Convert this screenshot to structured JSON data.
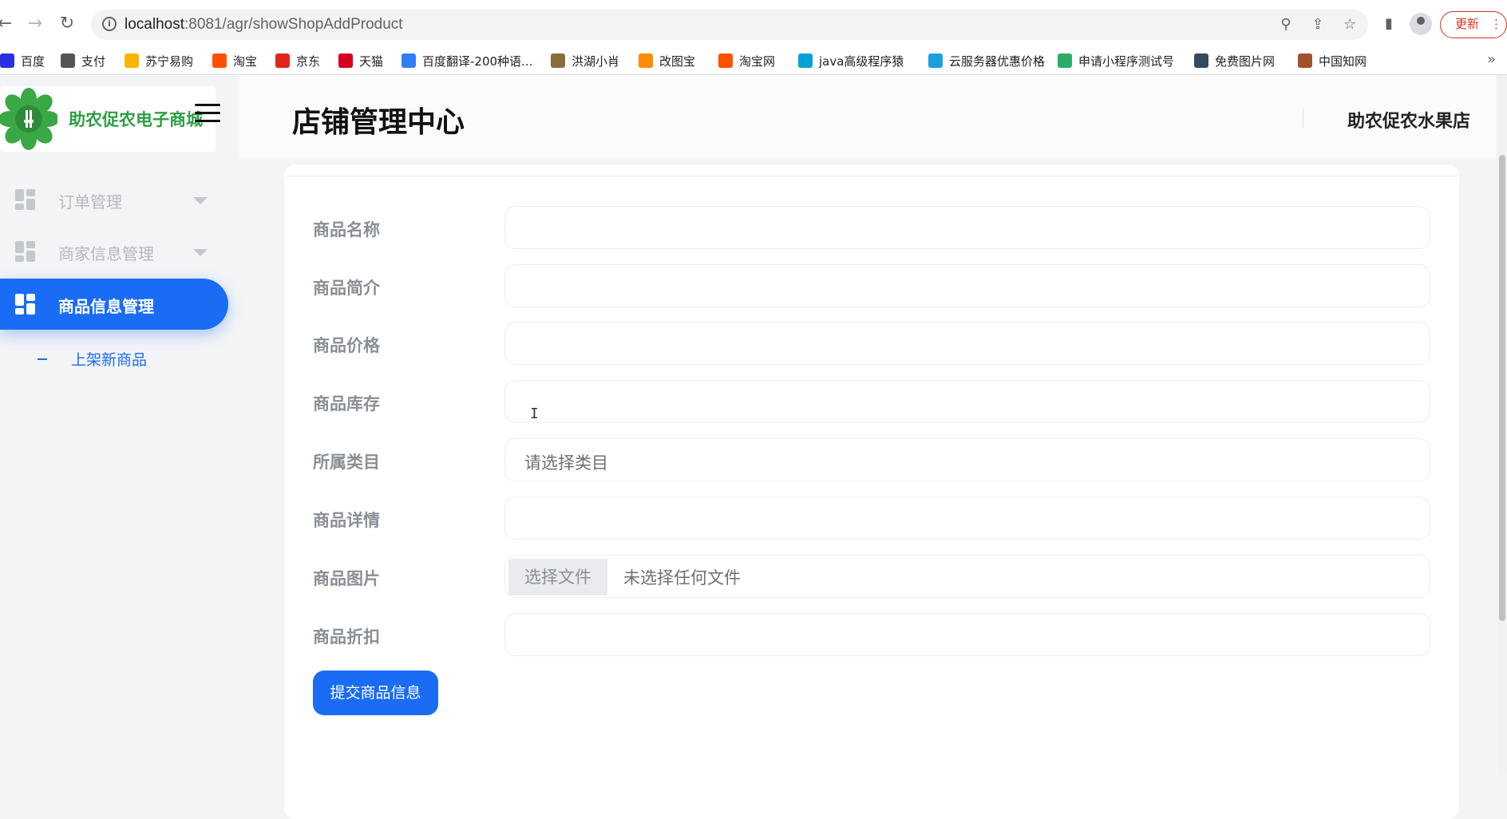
{
  "browser": {
    "url_host": "localhost",
    "url_rest": ":8081/agr/showShopAddProduct",
    "update_label": "更新",
    "bookmarks": [
      {
        "label": "百度",
        "color": "#2932e1"
      },
      {
        "label": "支付",
        "color": "#555555"
      },
      {
        "label": "苏宁易购",
        "color": "#f7b500"
      },
      {
        "label": "淘宝",
        "color": "#ff5000"
      },
      {
        "label": "京东",
        "color": "#e1251b"
      },
      {
        "label": "天猫",
        "color": "#d6001c"
      },
      {
        "label": "百度翻译-200种语...",
        "color": "#2f7ef7"
      },
      {
        "label": "洪湖小肖",
        "color": "#8b6d3c"
      },
      {
        "label": "改图宝",
        "color": "#ff8c00"
      },
      {
        "label": "淘宝网",
        "color": "#ff5000"
      },
      {
        "label": "java高级程序猿",
        "color": "#00a1d6"
      },
      {
        "label": "云服务器优惠价格",
        "color": "#1a9fe0"
      },
      {
        "label": "申请小程序测试号",
        "color": "#2aae67"
      },
      {
        "label": "免费图片网",
        "color": "#34495e"
      },
      {
        "label": "中国知网",
        "color": "#a0522d"
      }
    ]
  },
  "sidebar": {
    "logo_text": "助农促农电子商城",
    "items": [
      {
        "label": "订单管理",
        "active": false,
        "has_caret": true
      },
      {
        "label": "商家信息管理",
        "active": false,
        "has_caret": true
      },
      {
        "label": "商品信息管理",
        "active": true,
        "has_caret": false
      }
    ],
    "subitems": [
      {
        "label": "上架新商品"
      }
    ]
  },
  "header": {
    "title": "店铺管理中心",
    "shop_name": "助农促农水果店"
  },
  "form": {
    "fields": [
      {
        "label": "商品名称",
        "value": "",
        "placeholder": ""
      },
      {
        "label": "商品简介",
        "value": "",
        "placeholder": ""
      },
      {
        "label": "商品价格",
        "value": "",
        "placeholder": ""
      },
      {
        "label": "商品库存",
        "value": "",
        "placeholder": ""
      },
      {
        "label": "所属类目",
        "value": "",
        "placeholder": "请选择类目"
      },
      {
        "label": "商品详情",
        "value": "",
        "placeholder": ""
      },
      {
        "label": "商品图片",
        "file_button": "选择文件",
        "file_status": "未选择任何文件"
      },
      {
        "label": "商品折扣",
        "value": "",
        "placeholder": ""
      }
    ],
    "submit_label": "提交商品信息"
  },
  "colors": {
    "accent": "#1a6cf5",
    "brand_green": "#2e9e44"
  }
}
